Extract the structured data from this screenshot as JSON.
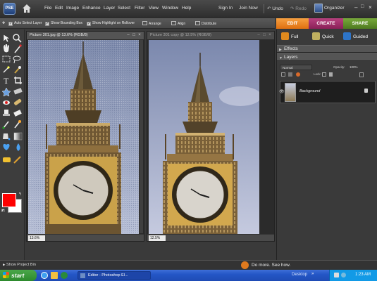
{
  "app": {
    "logo_text": "PSE",
    "menu": [
      "File",
      "Edit",
      "Image",
      "Enhance",
      "Layer",
      "Select",
      "Filter",
      "View",
      "Window",
      "Help"
    ],
    "sign_in": "Sign In",
    "join_now": "Join Now",
    "undo": "Undo",
    "redo": "Redo",
    "organizer": "Organizer"
  },
  "options_bar": {
    "auto_select_layer": "Auto Select Layer",
    "show_bounding_box": "Show Bounding Box",
    "show_highlight": "Show Highlight on Rollover",
    "arrange": "Arrange",
    "align": "Align",
    "distribute": "Distribute"
  },
  "mode_tabs": [
    "EDIT",
    "CREATE",
    "SHARE"
  ],
  "edit_subtabs": [
    "Full",
    "Quick",
    "Guided"
  ],
  "colors": {
    "edit_tab": "#e67e1e",
    "create_tab": "#9b2a68",
    "share_tab": "#5b8a2a",
    "foreground": "#ff0000",
    "background": "#ffffff"
  },
  "documents": [
    {
      "title": "Picture 301.jpg @ 13.6% (RGB/8)",
      "zoom": "13.6%",
      "active": true
    },
    {
      "title": "Picture 301 copy @ 12.5% (RGB/8)",
      "zoom": "12.5%",
      "active": false
    }
  ],
  "panels": {
    "effects": "Effects",
    "layers": "Layers",
    "blend_mode": "Normal",
    "opacity_label": "Opacity:",
    "opacity_value": "100%",
    "lock_label": "Lock:",
    "layer_name": "Background"
  },
  "bottom": {
    "project_bin": "Show Project Bin",
    "promo": "Do more. See how."
  },
  "taskbar": {
    "start": "start",
    "task": "Editor - Photoshop El...",
    "desktop": "Desktop",
    "clock": "1:23 AM"
  }
}
